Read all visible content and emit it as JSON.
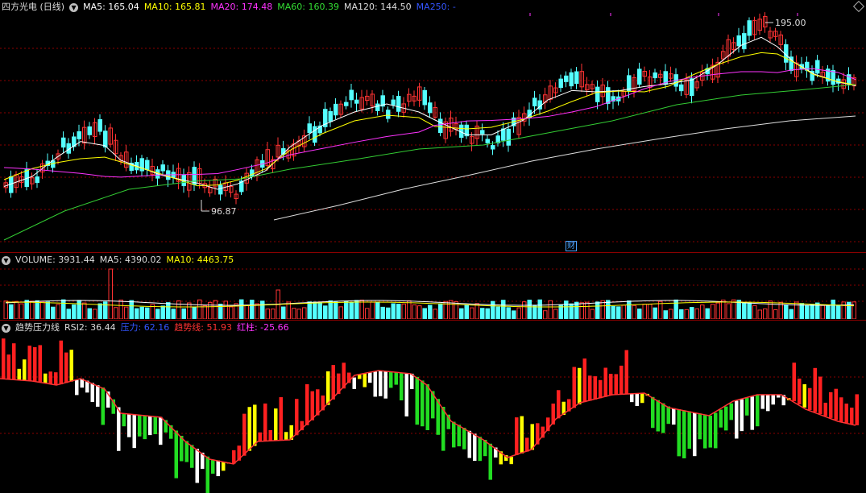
{
  "price": {
    "stock_name": "四方光电 (日线)",
    "ma5": "MA5: 165.04",
    "ma10": "MA10: 165.81",
    "ma20": "MA20: 174.48",
    "ma60": "MA60: 160.39",
    "ma120": "MA120: 144.50",
    "ma250": "MA250: -",
    "high_label": "195.00",
    "low_label": "96.87",
    "finance_marker": "财"
  },
  "volume": {
    "label": "VOLUME: 3931.44",
    "ma5": "MA5: 4390.02",
    "ma10": "MA10: 4463.75"
  },
  "rsi": {
    "name": "趋势压力线",
    "rsi2": "RSI2: 36.44",
    "pressure": "压力: 62.16",
    "trend": "趋势线: 51.93",
    "red_bar": "红柱: -25.66"
  },
  "colors": {
    "up": "#ff3333",
    "down": "#54ffff",
    "ma5": "#ffffff",
    "ma10": "#ffff00",
    "ma20": "#ff33ff",
    "ma60": "#33cc33",
    "ma120": "#dddddd",
    "ma250": "#3355ff",
    "bar_red": "#ff2020",
    "bar_yellow": "#ffff00",
    "bar_white": "#ffffff",
    "bar_green": "#22dd22",
    "grid": "#8b0000"
  }
}
